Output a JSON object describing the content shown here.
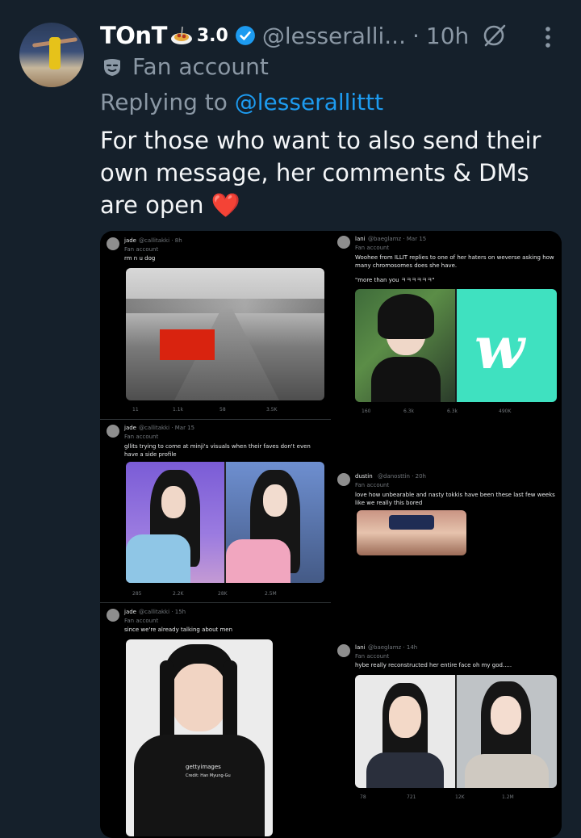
{
  "tweet": {
    "display_name": "TOnT",
    "version_badge": "3.0",
    "handle": "@lesseralli...",
    "separator": "·",
    "time": "10h",
    "affiliation_label": "Fan account",
    "replying_prefix": "Replying to ",
    "replying_handle": "@lesserallittt",
    "text": "For those who want to also send their own message, her comments & DMs are open",
    "emoji": "❤️"
  },
  "embedded": [
    {
      "name": "jade",
      "handle": "@callitakki · 8h",
      "label": "Fan account",
      "text": "rm n u dog",
      "stats": [
        "11",
        "1.1k",
        "58",
        "3.5K"
      ]
    },
    {
      "name": "lani",
      "handle": "@baeglamz · Mar 15",
      "label": "Fan account",
      "text": "Woohee from ILLIT replies to one of her haters on weverse asking how many chromosomes does she have.",
      "quote": "\"more than you ㅋㅋㅋㅋㅋㅋ\"",
      "stats": [
        "160",
        "6.3k",
        "6.3k",
        "490K"
      ]
    },
    {
      "name": "jade",
      "handle": "@callitakki · Mar 15",
      "label": "Fan account",
      "text": "gllits trying to come at minji's visuals when their faves don't even have a side profile",
      "stats": [
        "285",
        "2.2K",
        "28K",
        "2.5M"
      ]
    },
    {
      "name": "dustin",
      "handle": "@danosttin · 20h",
      "label": "Fan account",
      "text": "love how unbearable and nasty tokkis have been these last few weeks like we really this bored"
    },
    {
      "name": "jade",
      "handle": "@callitakki · 15h",
      "label": "Fan account",
      "text": "since we're already talking about men",
      "photo_credit": "gettyimages",
      "photo_credit_sub": "Credit: Han Myung-Gu"
    },
    {
      "name": "lani",
      "handle": "@baeglamz · 14h",
      "label": "Fan account",
      "text": "hybe really reconstructed her entire face oh my god.....",
      "stats": [
        "78",
        "721",
        "12K",
        "1.2M"
      ]
    }
  ],
  "icons": {
    "verified": "verified-badge-icon",
    "grok": "grok-icon",
    "more": "more-vertical-icon",
    "fan": "mask-icon",
    "plate": "spaghetti-emoji-icon"
  },
  "colors": {
    "background": "#15202b",
    "link": "#1d9bf0",
    "muted": "#8b98a5",
    "heart": "#e8323a"
  }
}
